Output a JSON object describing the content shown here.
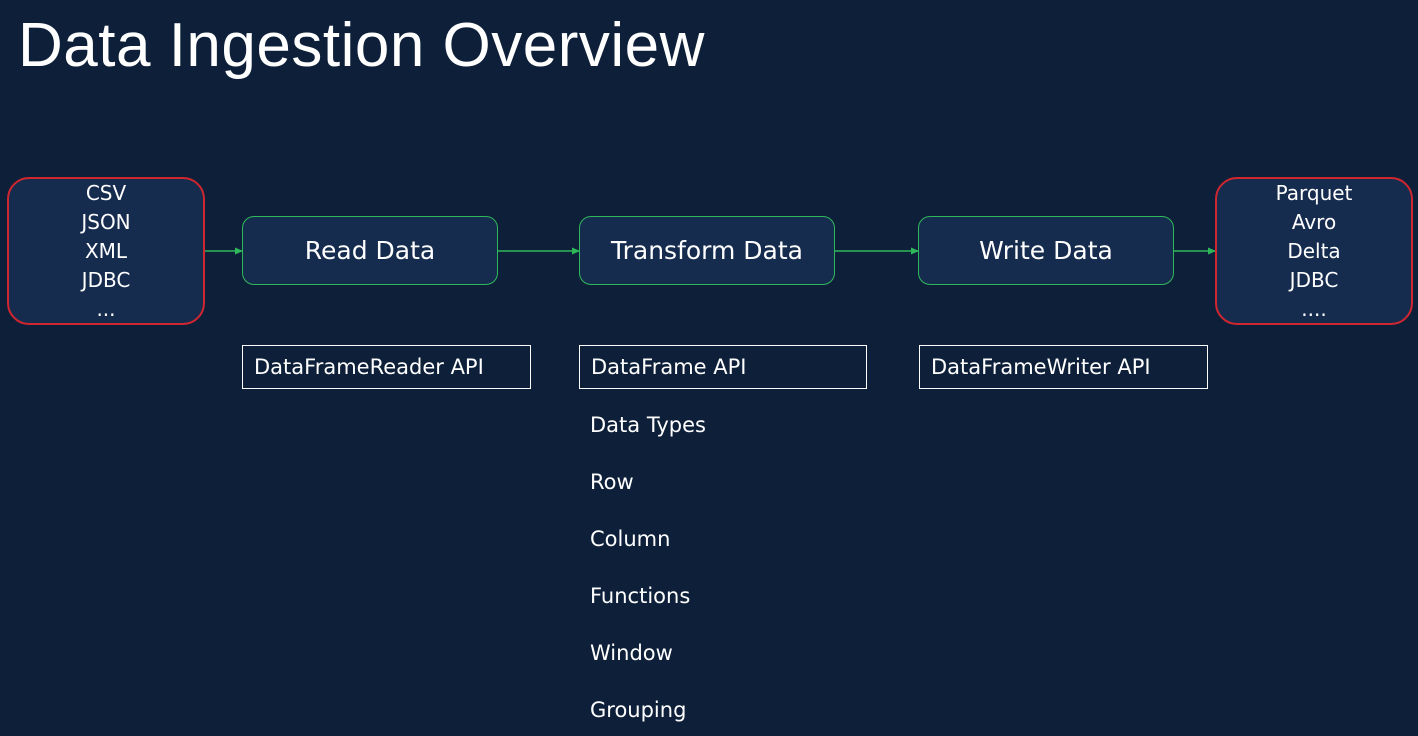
{
  "title": "Data Ingestion Overview",
  "colors": {
    "background": "#0e2039",
    "box_fill": "#162c4f",
    "source_border": "#d0262f",
    "stage_border": "#2fb85a",
    "arrow": "#2fb85a",
    "text": "#ffffff"
  },
  "sources": [
    "CSV",
    "JSON",
    "XML",
    "JDBC",
    "..."
  ],
  "stages": {
    "read": "Read Data",
    "transform": "Transform Data",
    "write": "Write Data"
  },
  "sinks": [
    "Parquet",
    "Avro",
    "Delta",
    "JDBC",
    "...."
  ],
  "apis": {
    "reader": "DataFrameReader API",
    "dataframe": "DataFrame API",
    "writer": "DataFrameWriter API"
  },
  "transform_topics": [
    "Data Types",
    "Row",
    "Column",
    "Functions",
    "Window",
    "Grouping"
  ]
}
